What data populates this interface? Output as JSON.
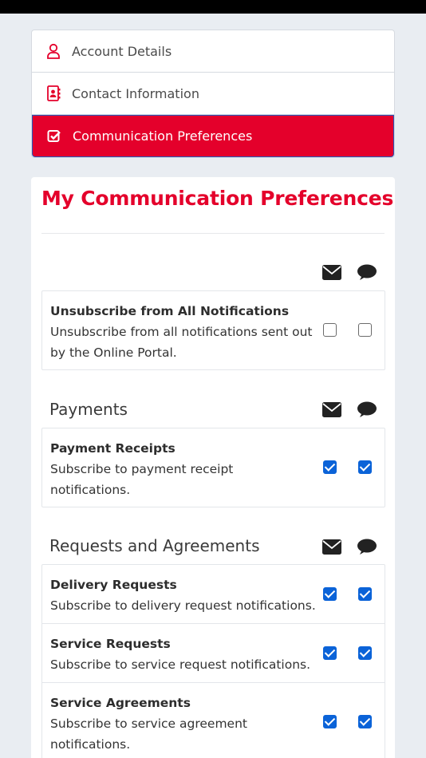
{
  "nav": {
    "items": [
      {
        "label": "Account Details",
        "icon": "user-icon",
        "active": false
      },
      {
        "label": "Contact Information",
        "icon": "contact-card-icon",
        "active": false
      },
      {
        "label": "Communication Preferences",
        "icon": "checkbox-icon",
        "active": true
      }
    ]
  },
  "main": {
    "title": "My Communication Preferences",
    "channel_icons": [
      "envelope-icon",
      "speech-bubble-icon"
    ],
    "general": {
      "rows": [
        {
          "title": "Unsubscribe from All Notifications",
          "desc_line1": "Unsubscribe from all notifications sent out",
          "desc_line2": "by the Online Portal.",
          "email": false,
          "sms": false
        }
      ]
    },
    "payments": {
      "title": "Payments",
      "rows": [
        {
          "title": "Payment Receipts",
          "desc_line1": "Subscribe to payment receipt",
          "desc_line2": "notifications.",
          "email": true,
          "sms": true
        }
      ]
    },
    "requests": {
      "title": "Requests and Agreements",
      "rows": [
        {
          "title": "Delivery Requests",
          "desc_line1": "Subscribe to delivery request notifications.",
          "desc_line2": "",
          "email": true,
          "sms": true
        },
        {
          "title": "Service Requests",
          "desc_line1": "Subscribe to service request notifications.",
          "desc_line2": "",
          "email": true,
          "sms": true
        },
        {
          "title": "Service Agreements",
          "desc_line1": "Subscribe to service agreement",
          "desc_line2": "notifications.",
          "email": true,
          "sms": true
        }
      ]
    }
  },
  "colors": {
    "brand": "#e4002b",
    "checkbox": "#0b63d8",
    "background": "#e9edf2"
  }
}
